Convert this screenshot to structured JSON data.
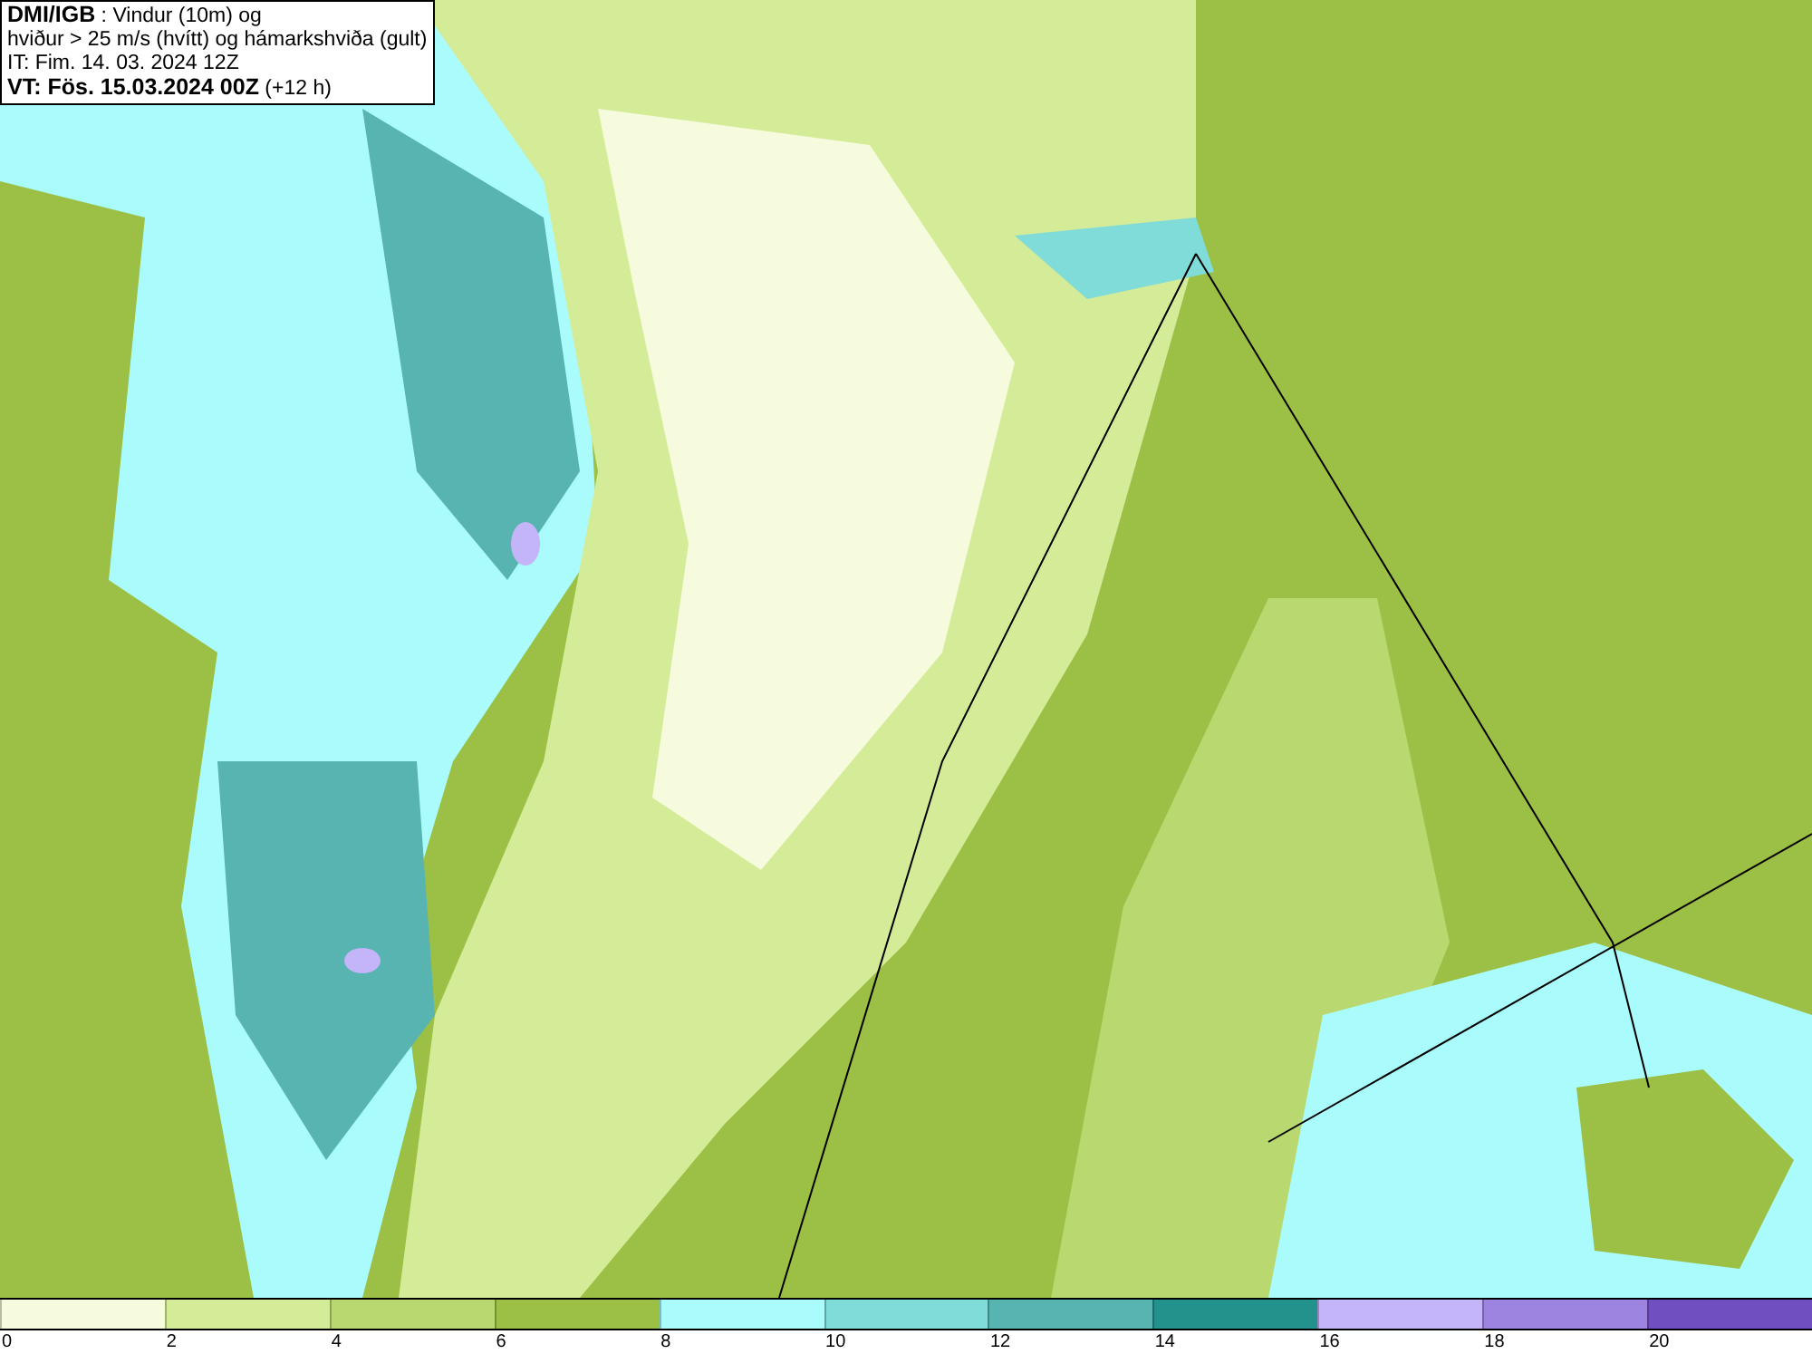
{
  "title_box": {
    "lines": [
      "**DMI/IGB** : Vindur (10m) og",
      "hviður > 25 m/s (hvítt) og hámarkshviða (gult)",
      "IT: Fim. 14. 03. 2024 12Z",
      "**VT: Fös. 15.03.2024 00Z** (+12 h)"
    ]
  },
  "legend": [
    {
      "label": "0",
      "color": "#f5fbdc"
    },
    {
      "label": "2",
      "color": "#d4eb98"
    },
    {
      "label": "4",
      "color": "#b9d870"
    },
    {
      "label": "6",
      "color": "#9cbf45"
    },
    {
      "label": "8",
      "color": "#aafcfc"
    },
    {
      "label": "10",
      "color": "#80dcd8"
    },
    {
      "label": "12",
      "color": "#58b4b0"
    },
    {
      "label": "14",
      "color": "#24928c"
    },
    {
      "label": "16",
      "color": "#c4b4f8"
    },
    {
      "label": "18",
      "color": "#9c84e0"
    },
    {
      "label": "20",
      "color": "#7050c0"
    }
  ]
}
